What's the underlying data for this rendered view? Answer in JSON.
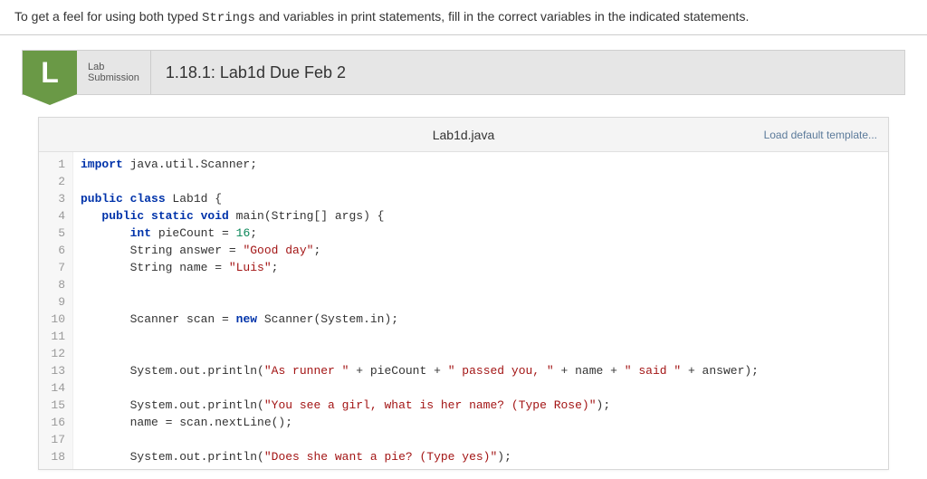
{
  "instruction": {
    "before": "To get a feel for using both typed ",
    "mono": "Strings",
    "after": " and variables in print statements, fill in the correct variables in the indicated statements."
  },
  "banner": {
    "badge": "L",
    "label_top": "Lab",
    "label_bottom": "Submission",
    "title": "1.18.1: Lab1d Due Feb 2"
  },
  "editor": {
    "filename": "Lab1d.java",
    "load_template": "Load default template...",
    "lines": [
      {
        "n": "1",
        "tokens": [
          {
            "c": "k",
            "t": "import"
          },
          {
            "c": "",
            "t": " java.util.Scanner;"
          }
        ]
      },
      {
        "n": "2",
        "tokens": []
      },
      {
        "n": "3",
        "tokens": [
          {
            "c": "k",
            "t": "public class"
          },
          {
            "c": "",
            "t": " Lab1d {"
          }
        ]
      },
      {
        "n": "4",
        "tokens": [
          {
            "c": "",
            "t": "   "
          },
          {
            "c": "k",
            "t": "public static void"
          },
          {
            "c": "",
            "t": " main(String[] args) {"
          }
        ]
      },
      {
        "n": "5",
        "tokens": [
          {
            "c": "",
            "t": "       "
          },
          {
            "c": "k",
            "t": "int"
          },
          {
            "c": "",
            "t": " pieCount = "
          },
          {
            "c": "num",
            "t": "16"
          },
          {
            "c": "",
            "t": ";"
          }
        ]
      },
      {
        "n": "6",
        "tokens": [
          {
            "c": "",
            "t": "       String answer = "
          },
          {
            "c": "s",
            "t": "\"Good day\""
          },
          {
            "c": "",
            "t": ";"
          }
        ]
      },
      {
        "n": "7",
        "tokens": [
          {
            "c": "",
            "t": "       String name = "
          },
          {
            "c": "s",
            "t": "\"Luis\""
          },
          {
            "c": "",
            "t": ";"
          }
        ]
      },
      {
        "n": "8",
        "tokens": []
      },
      {
        "n": "9",
        "tokens": []
      },
      {
        "n": "10",
        "tokens": [
          {
            "c": "",
            "t": "       Scanner scan = "
          },
          {
            "c": "k",
            "t": "new"
          },
          {
            "c": "",
            "t": " Scanner(System.in);"
          }
        ]
      },
      {
        "n": "11",
        "tokens": []
      },
      {
        "n": "12",
        "tokens": []
      },
      {
        "n": "13",
        "tokens": [
          {
            "c": "",
            "t": "       System.out.println("
          },
          {
            "c": "s",
            "t": "\"As runner \""
          },
          {
            "c": "",
            "t": " + pieCount + "
          },
          {
            "c": "s",
            "t": "\" passed you, \""
          },
          {
            "c": "",
            "t": " + name + "
          },
          {
            "c": "s",
            "t": "\" said \""
          },
          {
            "c": "",
            "t": " + answer);"
          }
        ]
      },
      {
        "n": "14",
        "tokens": []
      },
      {
        "n": "15",
        "tokens": [
          {
            "c": "",
            "t": "       System.out.println("
          },
          {
            "c": "s",
            "t": "\"You see a girl, what is her name? (Type Rose)\""
          },
          {
            "c": "",
            "t": ");"
          }
        ]
      },
      {
        "n": "16",
        "tokens": [
          {
            "c": "",
            "t": "       name = scan.nextLine();"
          }
        ]
      },
      {
        "n": "17",
        "tokens": []
      },
      {
        "n": "18",
        "tokens": [
          {
            "c": "",
            "t": "       System.out.println("
          },
          {
            "c": "s",
            "t": "\"Does she want a pie? (Type yes)\""
          },
          {
            "c": "",
            "t": ");"
          }
        ]
      }
    ]
  }
}
